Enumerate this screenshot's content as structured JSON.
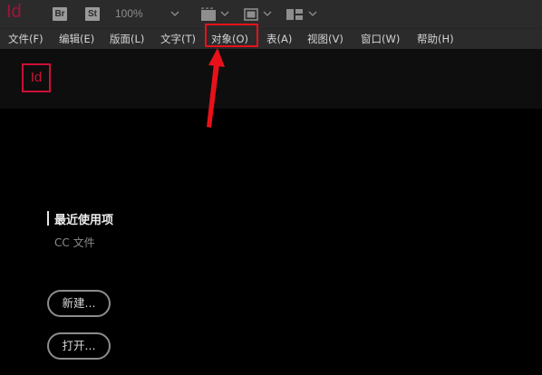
{
  "app": {
    "logo": "Id",
    "bridge_badge": "Br",
    "stock_badge": "St",
    "zoom": "100%"
  },
  "menu": {
    "items": [
      "文件(F)",
      "编辑(E)",
      "版面(L)",
      "文字(T)",
      "对象(O)",
      "表(A)",
      "视图(V)",
      "窗口(W)",
      "帮助(H)"
    ],
    "highlighted_index": 4
  },
  "home": {
    "logo": "Id",
    "nav_active": "最近使用项",
    "nav_item": "CC 文件",
    "new_button": "新建...",
    "open_button": "打开..."
  },
  "colors": {
    "accent_red": "#e8111a",
    "brand_id": "#cc1036"
  }
}
